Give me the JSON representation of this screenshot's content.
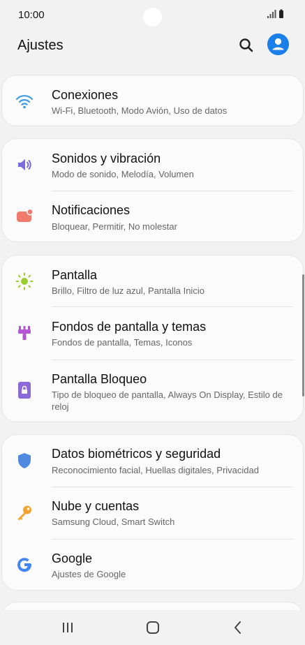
{
  "status": {
    "time": "10:00"
  },
  "header": {
    "title": "Ajustes"
  },
  "colors": {
    "accent": "#1a7fe8",
    "wifi": "#3d9ae8",
    "sound": "#7a6be0",
    "notif": "#f07a6b",
    "display": "#9ccc2e",
    "themes": "#b257d1",
    "lock": "#8a6ad8",
    "bio": "#4f8ae0",
    "cloud": "#f2a531",
    "google": "#4285f4"
  },
  "groups": [
    {
      "items": [
        {
          "icon": "wifi-icon",
          "title": "Conexiones",
          "subtitle": "Wi-Fi, Bluetooth, Modo Avión, Uso de datos"
        }
      ]
    },
    {
      "items": [
        {
          "icon": "speaker-icon",
          "title": "Sonidos y vibración",
          "subtitle": "Modo de sonido, Melodía, Volumen"
        },
        {
          "icon": "notification-icon",
          "title": "Notificaciones",
          "subtitle": "Bloquear, Permitir, No molestar"
        }
      ]
    },
    {
      "items": [
        {
          "icon": "brightness-icon",
          "title": "Pantalla",
          "subtitle": "Brillo, Filtro de luz azul, Pantalla Inicio"
        },
        {
          "icon": "brush-icon",
          "title": "Fondos de pantalla y temas",
          "subtitle": "Fondos de pantalla, Temas, Iconos"
        },
        {
          "icon": "lock-screen-icon",
          "title": "Pantalla Bloqueo",
          "subtitle": "Tipo de bloqueo de pantalla, Always On Display, Estilo de reloj"
        }
      ]
    },
    {
      "items": [
        {
          "icon": "shield-icon",
          "title": "Datos biométricos y seguridad",
          "subtitle": "Reconocimiento facial, Huellas digitales, Privacidad"
        },
        {
          "icon": "key-icon",
          "title": "Nube y cuentas",
          "subtitle": "Samsung Cloud, Smart Switch"
        },
        {
          "icon": "google-icon",
          "title": "Google",
          "subtitle": "Ajustes de Google"
        }
      ]
    }
  ],
  "nav": {
    "recents": "recents-icon",
    "home": "home-icon",
    "back": "back-icon"
  }
}
